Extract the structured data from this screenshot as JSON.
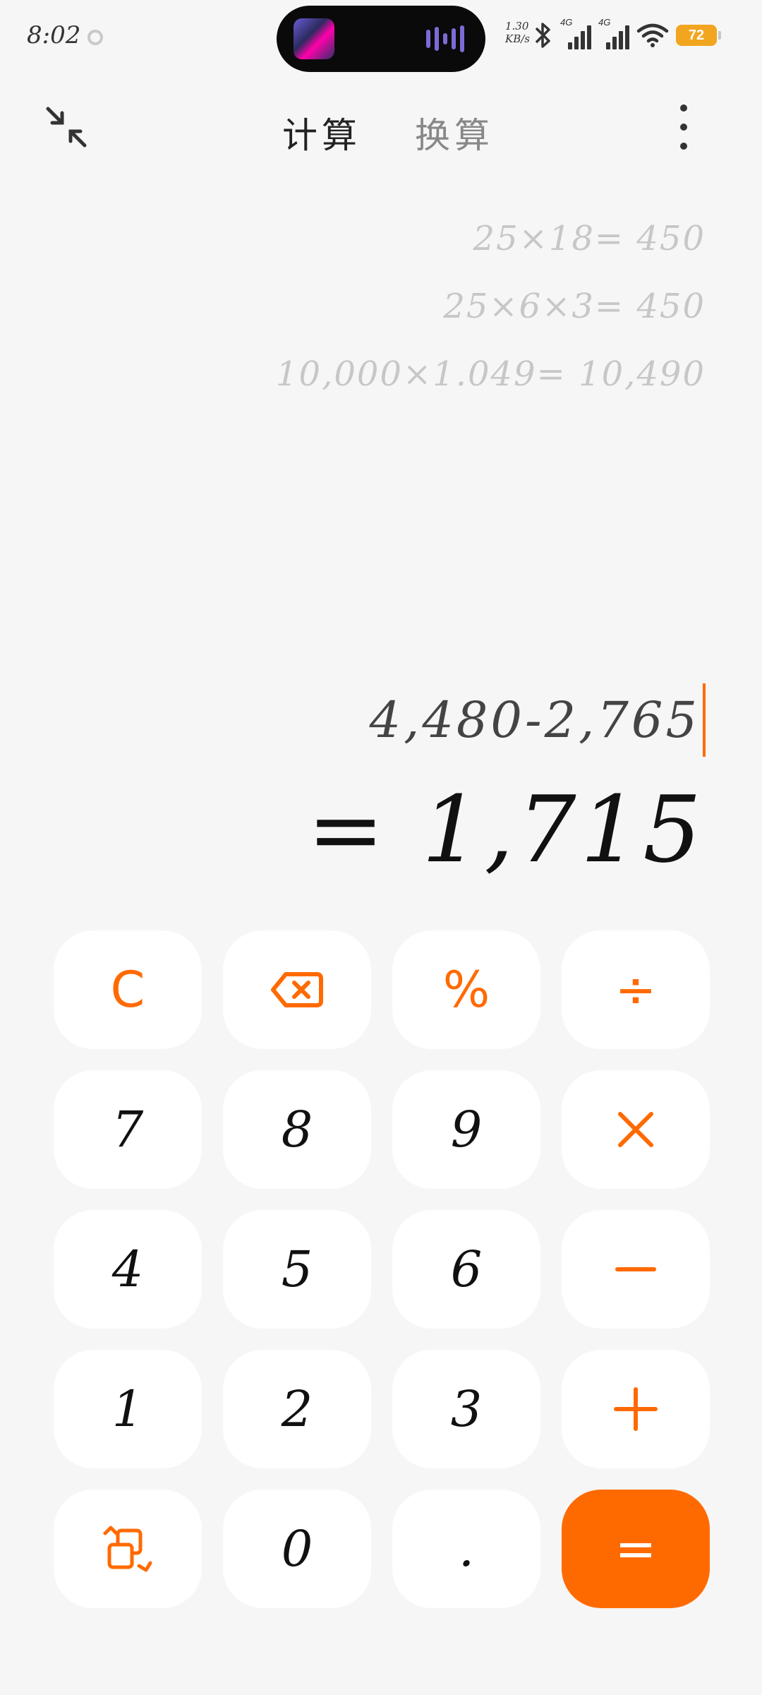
{
  "status_bar": {
    "time": "8:02",
    "net_speed_value": "1.30",
    "net_speed_unit": "KB/s",
    "sim1_tag": "4G",
    "sim2_tag": "4G",
    "battery": "72",
    "battery_color": "#f2a51f"
  },
  "app_bar": {
    "tabs": [
      {
        "label": "计算",
        "active": true
      },
      {
        "label": "换算",
        "active": false
      }
    ]
  },
  "history": [
    "25×18= 450",
    "25×6×3= 450",
    "10,000×1.049= 10,490"
  ],
  "display": {
    "expression": "4,480-2,765",
    "result": "= 1,715"
  },
  "keypad": {
    "row1": [
      "C",
      "backspace",
      "%",
      "÷"
    ],
    "digits": {
      "seven": "7",
      "eight": "8",
      "nine": "9",
      "four": "4",
      "five": "5",
      "six": "6",
      "one": "1",
      "two": "2",
      "three": "3",
      "zero": "0",
      "dot": "."
    },
    "equals": "="
  },
  "colors": {
    "accent": "#ff6a00",
    "background": "#f6f6f6",
    "key_background": "#ffffff",
    "history_text": "#c7c7c7"
  }
}
